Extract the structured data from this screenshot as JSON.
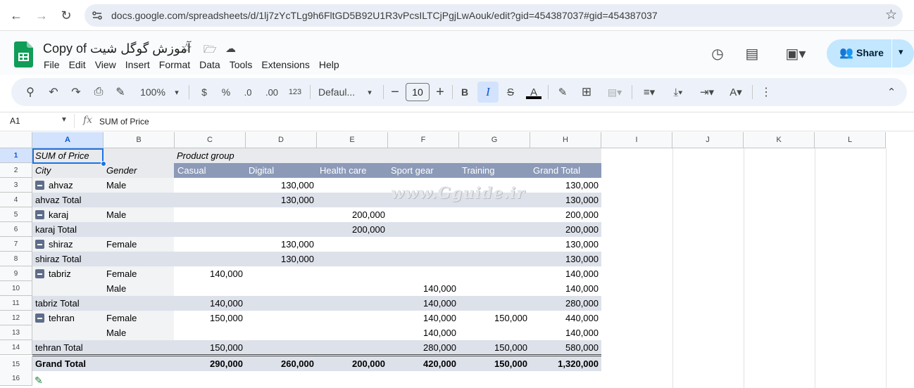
{
  "browser": {
    "url": "docs.google.com/spreadsheets/d/1lj7zYcTLg9h6FltGD5B92U1R3vPcsILTCjPgjLwAouk/edit?gid=454387037#gid=454387037",
    "back_icon": "arrow-left-icon",
    "forward_icon": "arrow-right-icon",
    "reload_icon": "reload-icon",
    "bookmark_icon": "star-icon"
  },
  "app": {
    "title": "Copy of آموزش گوگل شیت",
    "menus": [
      "File",
      "Edit",
      "View",
      "Insert",
      "Format",
      "Data",
      "Tools",
      "Extensions",
      "Help"
    ],
    "share_label": "Share"
  },
  "toolbar": {
    "zoom": "100%",
    "currency": "$",
    "percent": "%",
    "decrease_decimal": ".0",
    "increase_decimal": ".00",
    "number_format": "123",
    "font": "Defaul...",
    "font_size": "10",
    "bold": "B",
    "italic": "I",
    "text_color": "A"
  },
  "formula_bar": {
    "cell_ref": "A1",
    "fx": "fx",
    "formula": "SUM of Price"
  },
  "columns": [
    "A",
    "B",
    "C",
    "D",
    "E",
    "F",
    "G",
    "H",
    "I",
    "J",
    "K",
    "L"
  ],
  "rows": [
    "1",
    "2",
    "3",
    "4",
    "5",
    "6",
    "7",
    "8",
    "9",
    "10",
    "11",
    "12",
    "13",
    "14",
    "15",
    "16"
  ],
  "pivot": {
    "value_label": "SUM of Price",
    "column_group_label": "Product group",
    "row_header_1": "City",
    "row_header_2": "Gender",
    "col_headers": [
      "Casual",
      "Digital",
      "Health care",
      "Sport gear",
      "Training",
      "Grand Total"
    ],
    "body": [
      {
        "city": "ahvaz",
        "gender": "Male",
        "vals": [
          "",
          "130,000",
          "",
          "",
          "",
          "130,000"
        ],
        "expand": true
      },
      {
        "city": "ahvaz Total",
        "gender": "",
        "vals": [
          "",
          "130,000",
          "",
          "",
          "",
          "130,000"
        ],
        "total": true
      },
      {
        "city": "karaj",
        "gender": "Male",
        "vals": [
          "",
          "",
          "200,000",
          "",
          "",
          "200,000"
        ],
        "expand": true
      },
      {
        "city": "karaj Total",
        "gender": "",
        "vals": [
          "",
          "",
          "200,000",
          "",
          "",
          "200,000"
        ],
        "total": true
      },
      {
        "city": "shiraz",
        "gender": "Female",
        "vals": [
          "",
          "130,000",
          "",
          "",
          "",
          "130,000"
        ],
        "expand": true
      },
      {
        "city": "shiraz Total",
        "gender": "",
        "vals": [
          "",
          "130,000",
          "",
          "",
          "",
          "130,000"
        ],
        "total": true
      },
      {
        "city": "tabriz",
        "gender": "Female",
        "vals": [
          "140,000",
          "",
          "",
          "",
          "",
          "140,000"
        ],
        "expand": true
      },
      {
        "city": "",
        "gender": "Male",
        "vals": [
          "",
          "",
          "",
          "140,000",
          "",
          "140,000"
        ]
      },
      {
        "city": "tabriz Total",
        "gender": "",
        "vals": [
          "140,000",
          "",
          "",
          "140,000",
          "",
          "280,000"
        ],
        "total": true
      },
      {
        "city": "tehran",
        "gender": "Female",
        "vals": [
          "150,000",
          "",
          "",
          "140,000",
          "150,000",
          "440,000"
        ],
        "expand": true
      },
      {
        "city": "",
        "gender": "Male",
        "vals": [
          "",
          "",
          "",
          "140,000",
          "",
          "140,000"
        ]
      },
      {
        "city": "tehran Total",
        "gender": "",
        "vals": [
          "150,000",
          "",
          "",
          "280,000",
          "150,000",
          "580,000"
        ],
        "total": true
      }
    ],
    "grand_total": {
      "label": "Grand Total",
      "vals": [
        "290,000",
        "260,000",
        "200,000",
        "420,000",
        "150,000",
        "1,320,000"
      ]
    }
  },
  "watermark": "www.Gguide.ir"
}
